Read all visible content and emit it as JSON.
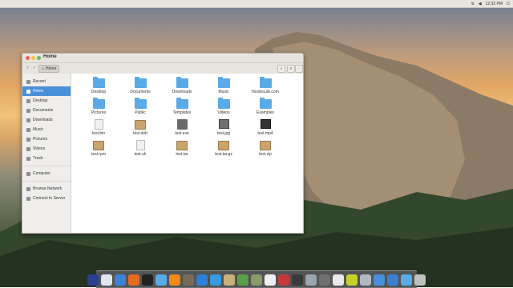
{
  "window": {
    "title": "Home",
    "path_label": "Home",
    "traffic_colors": [
      "#ee5e57",
      "#f5bd4f",
      "#5fc453"
    ]
  },
  "topbar": {
    "time": "12:32 PM",
    "icons": [
      "network-icon",
      "volume-icon",
      "power-icon"
    ]
  },
  "sidebar": {
    "items": [
      {
        "label": "Recent",
        "icon": "clock-icon"
      },
      {
        "label": "Home",
        "icon": "home-icon",
        "active": true
      },
      {
        "label": "Desktop",
        "icon": "desktop-icon"
      },
      {
        "label": "Documents",
        "icon": "documents-icon"
      },
      {
        "label": "Downloads",
        "icon": "downloads-icon"
      },
      {
        "label": "Music",
        "icon": "music-icon"
      },
      {
        "label": "Pictures",
        "icon": "pictures-icon"
      },
      {
        "label": "Videos",
        "icon": "videos-icon"
      },
      {
        "label": "Trash",
        "icon": "trash-icon"
      },
      {
        "label": "Computer",
        "icon": "computer-icon"
      },
      {
        "label": "Browse Network",
        "icon": "network-icon"
      },
      {
        "label": "Connect to Server",
        "icon": "server-icon"
      }
    ]
  },
  "files": [
    {
      "name": "Desktop",
      "type": "folder"
    },
    {
      "name": "Documents",
      "type": "folder"
    },
    {
      "name": "Downloads",
      "type": "folder"
    },
    {
      "name": "Music",
      "type": "folder"
    },
    {
      "name": "NoobsLab.com",
      "type": "folder"
    },
    {
      "name": "Pictures",
      "type": "folder"
    },
    {
      "name": "Public",
      "type": "folder"
    },
    {
      "name": "Templates",
      "type": "folder"
    },
    {
      "name": "Videos",
      "type": "folder"
    },
    {
      "name": "Examples",
      "type": "folder"
    },
    {
      "name": "test.bin",
      "type": "doc"
    },
    {
      "name": "test.deb",
      "type": "package"
    },
    {
      "name": "test.exe",
      "type": "exe"
    },
    {
      "name": "test.jpg",
      "type": "image"
    },
    {
      "name": "test.mp4",
      "type": "video"
    },
    {
      "name": "test.rpm",
      "type": "package"
    },
    {
      "name": "test.sh",
      "type": "doc"
    },
    {
      "name": "test.tar",
      "type": "package"
    },
    {
      "name": "test.tar.gz",
      "type": "package"
    },
    {
      "name": "test.zip",
      "type": "package"
    }
  ],
  "dock": {
    "items": [
      {
        "name": "launcher",
        "color": "#2a3f8f"
      },
      {
        "name": "safari",
        "color": "#dfe6ee"
      },
      {
        "name": "finder",
        "color": "#3b83d8"
      },
      {
        "name": "firefox",
        "color": "#e66b1f"
      },
      {
        "name": "terminal",
        "color": "#222222"
      },
      {
        "name": "files",
        "color": "#5aaae8"
      },
      {
        "name": "vlc",
        "color": "#f08a1c"
      },
      {
        "name": "gimp",
        "color": "#7a6a55"
      },
      {
        "name": "chrome",
        "color": "#2f7fd8"
      },
      {
        "name": "app-store",
        "color": "#3a9be0"
      },
      {
        "name": "photos",
        "color": "#c9b27a"
      },
      {
        "name": "plant",
        "color": "#5aa04a"
      },
      {
        "name": "bird",
        "color": "#8a9a6a"
      },
      {
        "name": "documents",
        "color": "#efefef"
      },
      {
        "name": "preview",
        "color": "#c23b3b"
      },
      {
        "name": "monitor",
        "color": "#3a3a3a"
      },
      {
        "name": "update",
        "color": "#9aa5b0"
      },
      {
        "name": "settings",
        "color": "#707070"
      },
      {
        "name": "itunes",
        "color": "#e9e9e9"
      },
      {
        "name": "dvd",
        "color": "#c8d02a"
      },
      {
        "name": "mail",
        "color": "#b0b8c2"
      },
      {
        "name": "desktop",
        "color": "#4a90d9"
      },
      {
        "name": "help",
        "color": "#3a7fd0"
      },
      {
        "name": "folder",
        "color": "#5aaae8"
      },
      {
        "name": "trash",
        "color": "#c0c0c0"
      }
    ]
  }
}
